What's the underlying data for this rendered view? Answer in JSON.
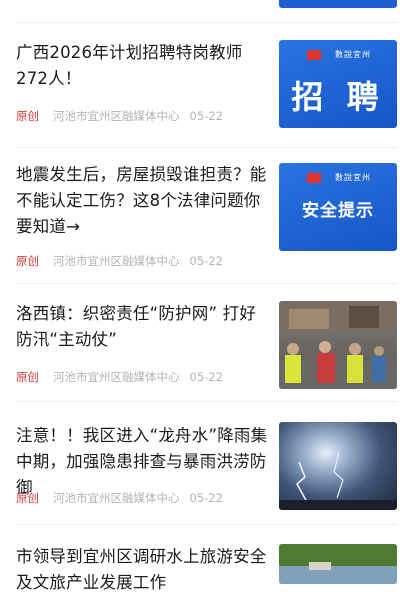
{
  "articles": [
    {
      "title": "广西2026年计划招聘特岗教师272人！",
      "original": "原创",
      "source": "河池市宜州区融媒体中心",
      "date": "05-22",
      "thumb": {
        "type": "graphic",
        "logo": "數說宜州",
        "text": "招 聘"
      }
    },
    {
      "title": "地震发生后，房屋损毁谁担责？能不能认定工伤？这8个法律问题你要知道→",
      "original": "原创",
      "source": "河池市宜州区融媒体中心",
      "date": "05-22",
      "thumb": {
        "type": "graphic",
        "logo": "數說宜州",
        "text": "安全提示"
      }
    },
    {
      "title": "洛西镇：织密责任“防护网” 打好防汛“主动仗”",
      "original": "原创",
      "source": "河池市宜州区融媒体中心",
      "date": "05-22",
      "thumb": {
        "type": "photo"
      }
    },
    {
      "title": "注意！！我区进入“龙舟水”降雨集中期，加强隐患排查与暴雨洪涝防御",
      "original": "原创",
      "source": "河池市宜州区融媒体中心",
      "date": "05-22",
      "thumb": {
        "type": "photo"
      }
    },
    {
      "title": "市领导到宜州区调研水上旅游安全及文旅产业发展工作",
      "thumb": {
        "type": "photo"
      }
    }
  ],
  "colors": {
    "original_tag": "#d23a3a",
    "meta_text": "#b3b3b3",
    "graphic_bg": "#1d5fcf"
  }
}
